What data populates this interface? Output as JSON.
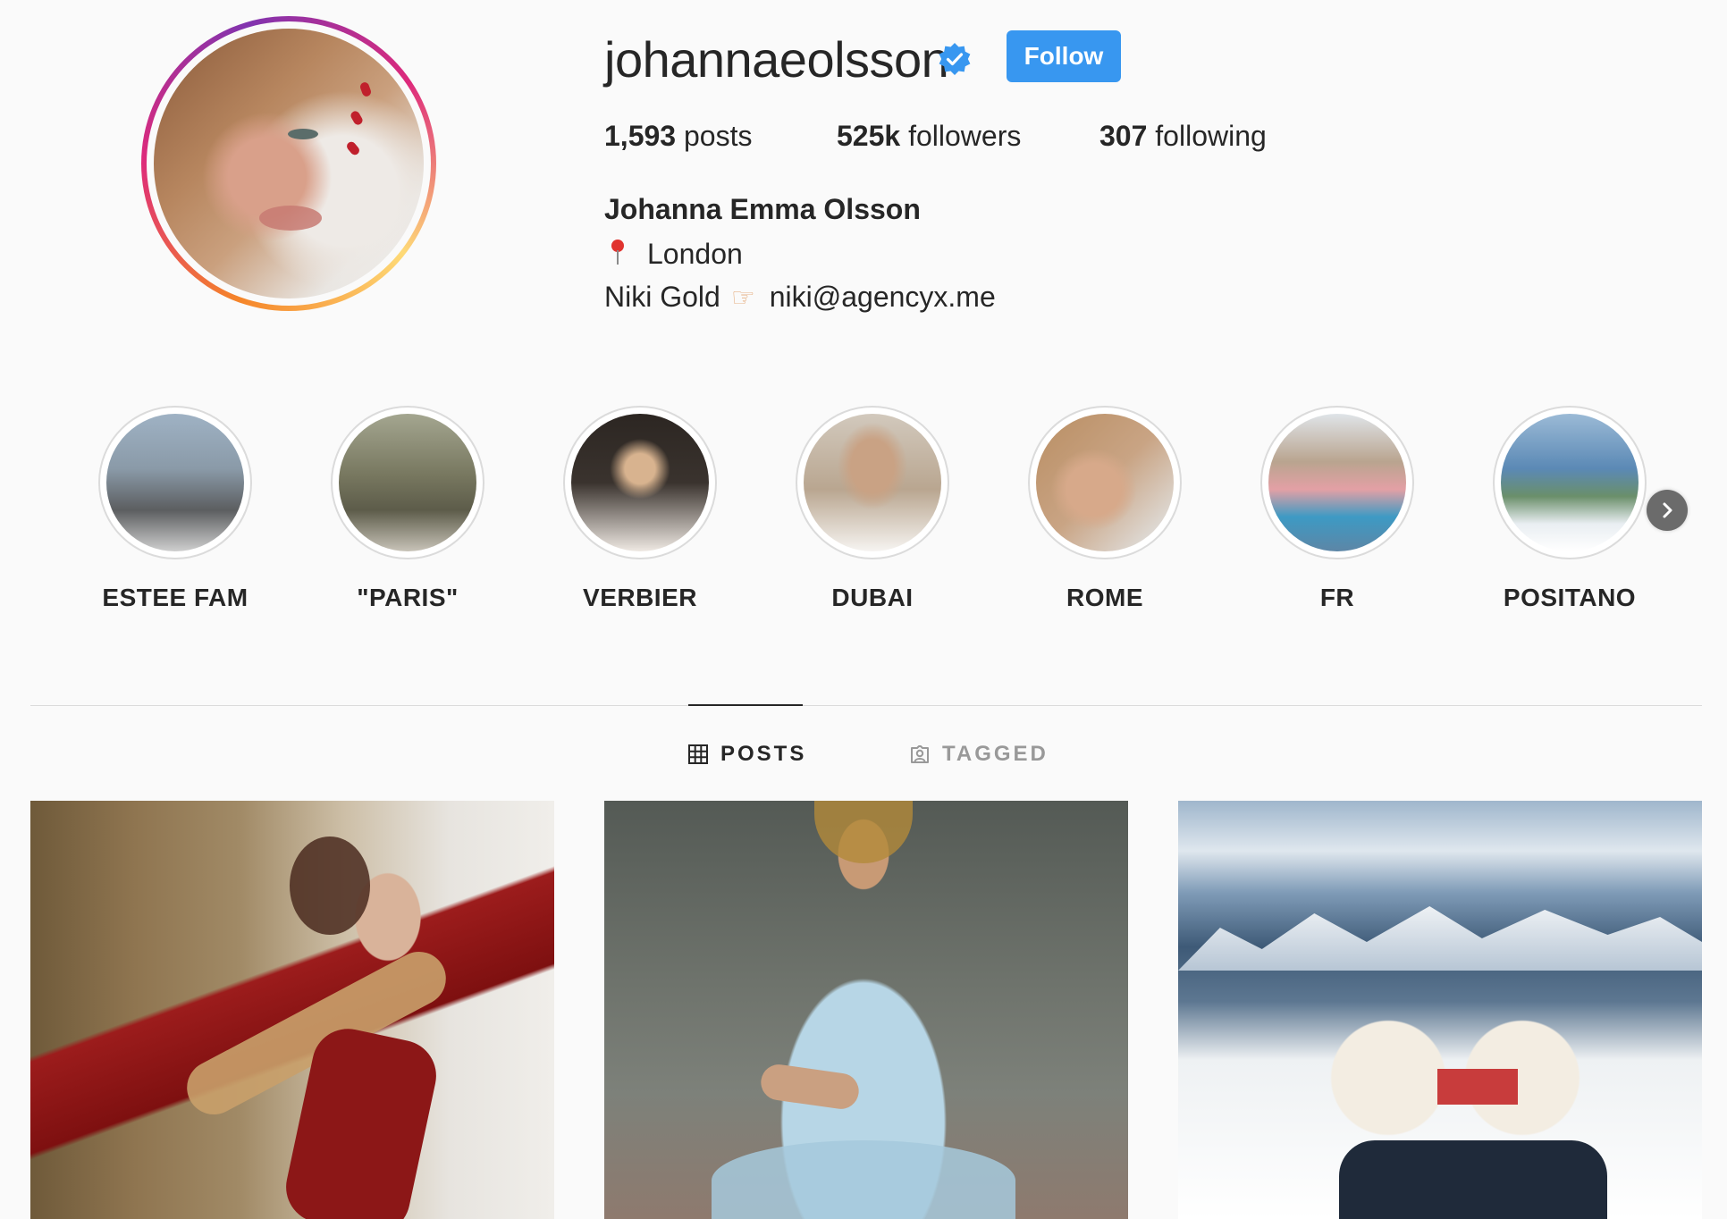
{
  "profile": {
    "username": "johannaeolsson",
    "follow_label": "Follow",
    "stats": {
      "posts_count": "1,593",
      "posts_label": "posts",
      "followers_count": "525k",
      "followers_label": "followers",
      "following_count": "307",
      "following_label": "following"
    },
    "bio": {
      "full_name": "Johanna Emma Olsson",
      "location": "London",
      "contact_name": "Niki Gold",
      "contact_email": "niki@agencyx.me"
    }
  },
  "highlights": [
    {
      "label": "ESTEE FAM",
      "color": "#7c8a98"
    },
    {
      "label": "\"PARIS\"",
      "color": "#7c7d68"
    },
    {
      "label": "VERBIER",
      "color": "#3a332e"
    },
    {
      "label": "DUBAI",
      "color": "#b9a690"
    },
    {
      "label": "ROME",
      "color": "#c9a484"
    },
    {
      "label": "FR",
      "color": "#5d86a6"
    },
    {
      "label": "POSITANO",
      "color": "#5b89b5"
    }
  ],
  "tabs": {
    "posts_label": "POSTS",
    "tagged_label": "TAGGED"
  },
  "colors": {
    "accent": "#3897f0",
    "verified": "#3897f0",
    "text": "#262626",
    "muted": "#999999"
  },
  "icons": {
    "verified": "verified-badge-icon",
    "location": "location-pin-icon",
    "pointing": "hand-pointing-right-icon",
    "grid": "grid-icon",
    "tagged": "tagged-user-icon",
    "next": "chevron-right-icon"
  }
}
